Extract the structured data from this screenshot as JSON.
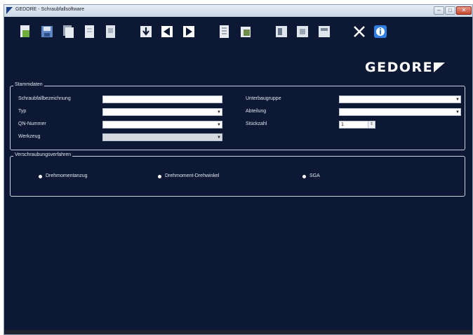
{
  "window": {
    "title": "GEDORE - Schraubfallsoftware"
  },
  "titlebar": {
    "minimize": "–",
    "maximize": "□",
    "close": "✕"
  },
  "toolbar": {
    "buttons": [
      {
        "name": "new-document-button",
        "icon": "document-plus-icon",
        "color": "#6fae3c"
      },
      {
        "name": "save-button",
        "icon": "floppy-disk-icon",
        "color": "#5d87c7"
      },
      {
        "name": "copy-button",
        "icon": "copy-document-icon",
        "color": "#c8d0da"
      },
      {
        "name": "paste-button",
        "icon": "document-icon",
        "color": "#c8d0da"
      },
      {
        "name": "document-button",
        "icon": "document-icon",
        "color": "#c8d0da"
      },
      {
        "name": "import-button",
        "icon": "import-arrow-icon",
        "color": "#e8ecf2"
      },
      {
        "name": "previous-button",
        "icon": "arrow-left-icon",
        "color": "#ffffff"
      },
      {
        "name": "next-button",
        "icon": "arrow-right-icon",
        "color": "#ffffff"
      },
      {
        "name": "report-button",
        "icon": "report-icon",
        "color": "#e8ecf2"
      },
      {
        "name": "export-button",
        "icon": "export-icon",
        "color": "#e8ecf2"
      },
      {
        "name": "excel-button",
        "icon": "excel-icon",
        "color": "#dfe5ec"
      },
      {
        "name": "print-button",
        "icon": "print-icon",
        "color": "#dfe5ec"
      },
      {
        "name": "template-button",
        "icon": "template-icon",
        "color": "#dfe5ec"
      },
      {
        "name": "settings-button",
        "icon": "tools-icon",
        "color": "#ffffff"
      },
      {
        "name": "info-button",
        "icon": "info-icon",
        "color": "#2f7fe0"
      }
    ]
  },
  "logo": {
    "text": "GEDORE"
  },
  "stammdaten": {
    "legend": "Stammdaten",
    "schraubfall_label": "Schraubfallbezeichnung",
    "schraubfall_value": "",
    "typ_label": "Typ",
    "typ_value": "",
    "qn_label": "QN-Nummer",
    "qn_value": "",
    "werkzeug_label": "Werkzeug",
    "werkzeug_value": "",
    "unterbaugruppe_label": "Unterbaugruppe",
    "unterbaugruppe_value": "",
    "abteilung_label": "Abteilung",
    "abteilung_value": "",
    "stueckzahl_label": "Stückzahl",
    "stueckzahl_value": "1"
  },
  "verfahren": {
    "legend": "Verschraubungsverfahren",
    "options": [
      {
        "label": "Drehmomentanzug"
      },
      {
        "label": "Drehmoment-Drehwinkel"
      },
      {
        "label": "SGA"
      }
    ]
  },
  "colors": {
    "background": "#0c1834",
    "accent": "#ffffff"
  }
}
